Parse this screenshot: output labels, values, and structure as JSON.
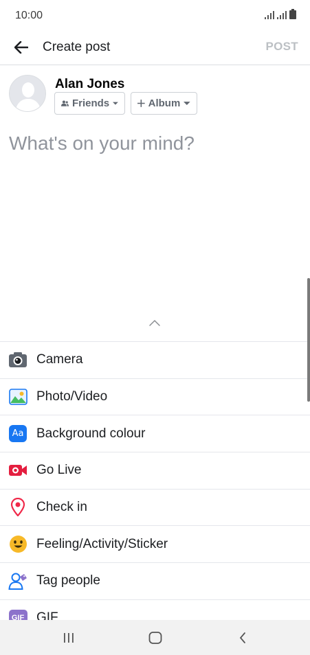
{
  "status_bar": {
    "time": "10:00"
  },
  "app_bar": {
    "title": "Create post",
    "post_label": "POST"
  },
  "profile": {
    "name": "Alan Jones",
    "audience_label": "Friends",
    "album_label": "Album"
  },
  "composer": {
    "placeholder": "What's on your mind?"
  },
  "options": [
    {
      "label": "Camera",
      "icon": "camera-icon"
    },
    {
      "label": "Photo/Video",
      "icon": "photo-icon"
    },
    {
      "label": "Background colour",
      "icon": "background-colour-icon",
      "icon_text": "Aa"
    },
    {
      "label": "Go Live",
      "icon": "live-video-icon"
    },
    {
      "label": "Check in",
      "icon": "location-pin-icon"
    },
    {
      "label": "Feeling/Activity/Sticker",
      "icon": "smiley-icon"
    },
    {
      "label": "Tag people",
      "icon": "tag-people-icon"
    },
    {
      "label": "GIF",
      "icon": "gif-icon",
      "icon_text": "GIF"
    }
  ],
  "colors": {
    "post_disabled": "#bcc0c4",
    "background_icon": "#1877f2",
    "live_icon": "#e41e3f",
    "checkin_icon": "#f02849",
    "feeling_icon": "#f7b928",
    "gif_icon": "#8c72cb"
  }
}
